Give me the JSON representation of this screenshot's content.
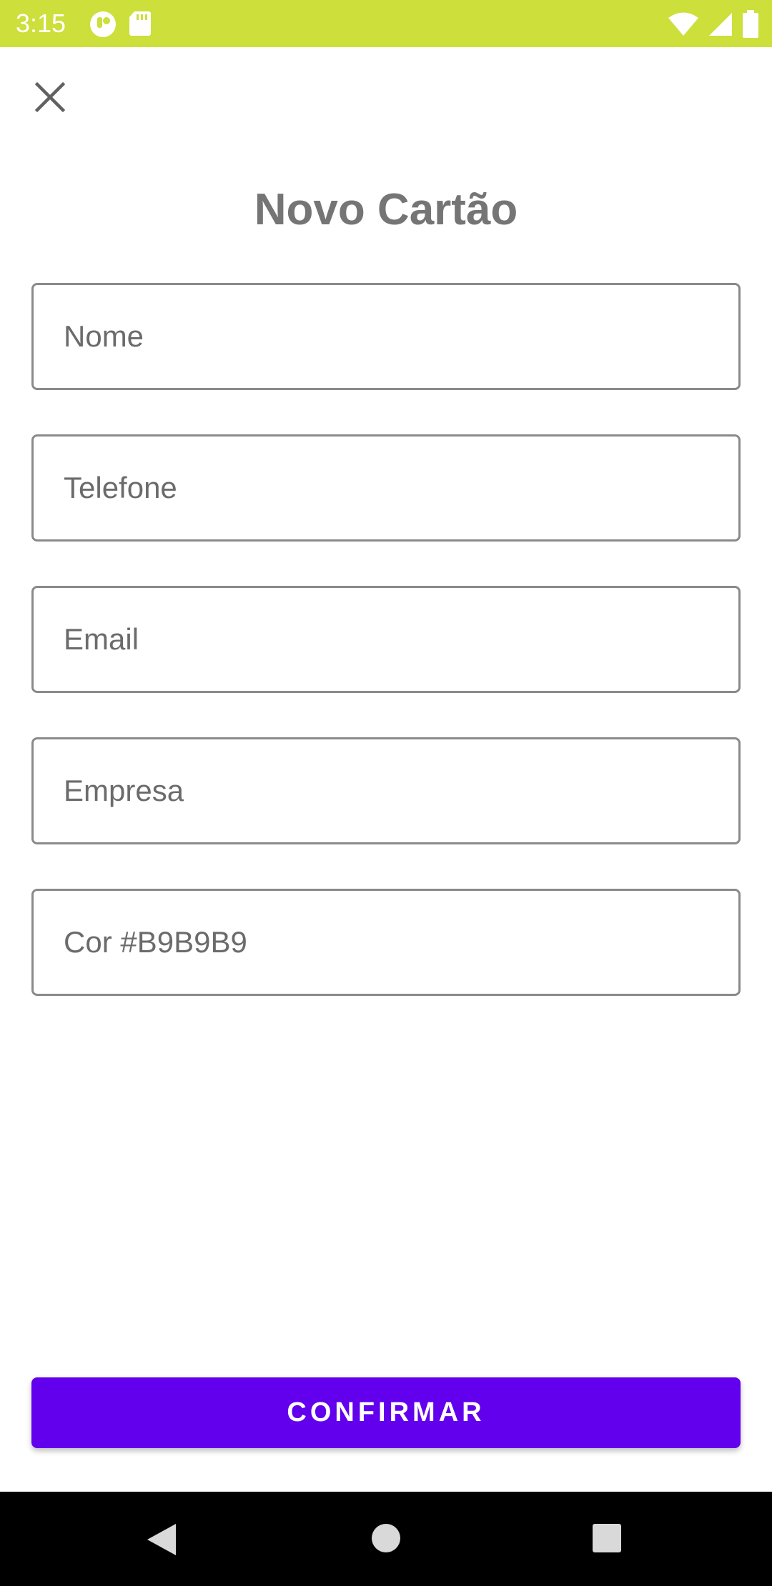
{
  "status_bar": {
    "time": "3:15",
    "background_color": "#cddf3a",
    "left_icons": [
      "notification-app-icon",
      "sd-card-icon"
    ],
    "right_icons": [
      "wifi-icon",
      "cell-signal-icon",
      "battery-icon"
    ]
  },
  "header": {
    "close_icon": "close-icon"
  },
  "main": {
    "title": "Novo Cartão",
    "fields": [
      {
        "name": "nome-field",
        "value": "",
        "placeholder": "Nome"
      },
      {
        "name": "telefone-field",
        "value": "",
        "placeholder": "Telefone"
      },
      {
        "name": "email-field",
        "value": "",
        "placeholder": "Email"
      },
      {
        "name": "empresa-field",
        "value": "",
        "placeholder": "Empresa"
      },
      {
        "name": "cor-field",
        "value": "",
        "placeholder": "Cor #B9B9B9"
      }
    ],
    "confirm_label": "CONFIRMAR",
    "accent_color": "#6200ee"
  },
  "nav_bar": {
    "icons": [
      "back-icon",
      "home-icon",
      "recents-icon"
    ]
  }
}
